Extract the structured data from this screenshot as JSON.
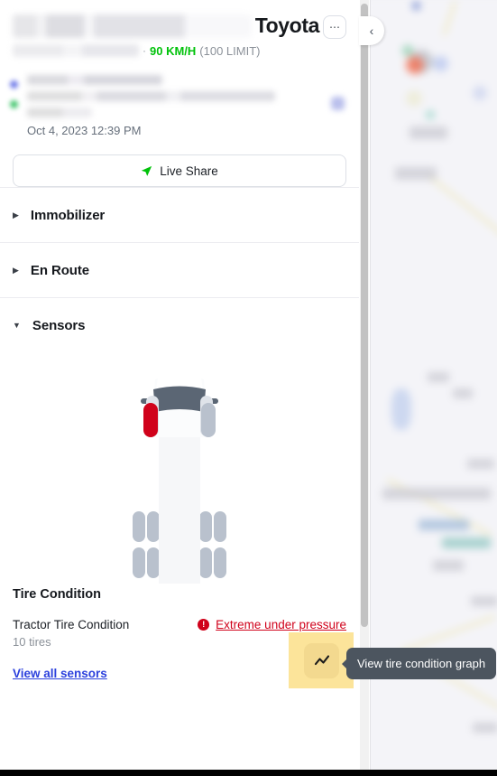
{
  "header": {
    "vehicle_name_redacted": true,
    "brand": "Toyota",
    "menu_icon": "ellipsis-icon",
    "separator": "·",
    "speed": "90 KM/H",
    "speed_limit": "(100 LIMIT)",
    "speed_color": "#00c20a"
  },
  "location": {
    "address_redacted": true,
    "timestamp": "Oct 4, 2023 12:39 PM"
  },
  "live_share": {
    "label": "Live Share",
    "icon": "navigation-arrow-icon",
    "icon_color": "#00c20a"
  },
  "sections": [
    {
      "label": "Immobilizer",
      "expanded": false,
      "caret": "▶"
    },
    {
      "label": "En Route",
      "expanded": false,
      "caret": "▶"
    },
    {
      "label": "Sensors",
      "expanded": true,
      "caret": "▼"
    }
  ],
  "truck": {
    "alt": "top-down tractor diagram",
    "alert_tire": "front-left",
    "alert_color": "#d0021b",
    "body_color": "#f4f5f7",
    "tire_color": "#b9c1cd",
    "windshield_color": "#5b6674"
  },
  "tire_condition": {
    "title": "Tire Condition",
    "row_name": "Tractor Tire Condition",
    "row_sub": "10 tires",
    "status_text": "Extreme under pressure",
    "status_color": "#d0021b",
    "status_icon": "error-circle-icon",
    "view_all_label": "View all sensors",
    "view_all_color": "#2c41dd"
  },
  "graph_button": {
    "icon": "line-chart-icon",
    "highlight_color": "#fce49a",
    "button_color": "#f3d98f"
  },
  "tooltip": {
    "text": "View tire condition graph",
    "background": "#4c555f",
    "text_color": "#ffffff"
  },
  "map": {
    "blurred": true,
    "collapse_icon": "chevron-left-icon"
  },
  "scrollbar": {
    "orientation": "vertical",
    "thumb_color": "#c2c2c2"
  }
}
